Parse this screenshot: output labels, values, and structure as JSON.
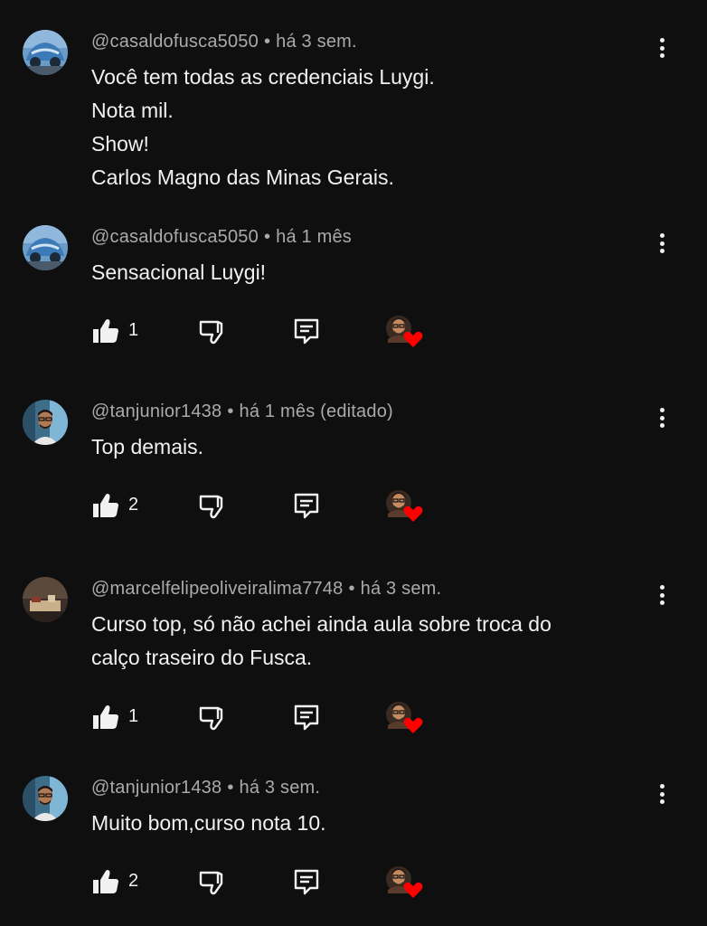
{
  "colors": {
    "background": "#0f0f0f",
    "text": "#f1f1f1",
    "secondary": "#aaaaaa",
    "heart": "#ff0000"
  },
  "icons": {
    "like": "thumb-up-icon",
    "dislike": "thumb-down-icon",
    "reply": "reply-comment-icon",
    "creator_heart": "creator-heart-icon",
    "menu": "more-vertical-icon"
  },
  "comments": [
    {
      "author": "@casaldofusca5050",
      "separator": "•",
      "time": "há 3 sem.",
      "lines": [
        "Você tem todas as credenciais Luygi.",
        "Nota mil.",
        "Show!",
        "Carlos Magno das Minas Gerais."
      ],
      "likes": null
    },
    {
      "author": "@casaldofusca5050",
      "separator": "•",
      "time": "há 1 mês",
      "lines": [
        "Sensacional Luygi!"
      ],
      "likes": "1"
    },
    {
      "author": "@tanjunior1438",
      "separator": "•",
      "time": "há 1 mês (editado)",
      "lines": [
        "Top demais."
      ],
      "likes": "2"
    },
    {
      "author": "@marcelfelipeoliveiralima7748",
      "separator": "•",
      "time": "há 3 sem.",
      "lines": [
        "Curso top, só não achei ainda aula sobre troca do",
        "calço traseiro do Fusca."
      ],
      "likes": "1"
    },
    {
      "author": "@tanjunior1438",
      "separator": "•",
      "time": "há 3 sem.",
      "lines": [
        "Muito bom,curso nota 10."
      ],
      "likes": "2"
    }
  ]
}
